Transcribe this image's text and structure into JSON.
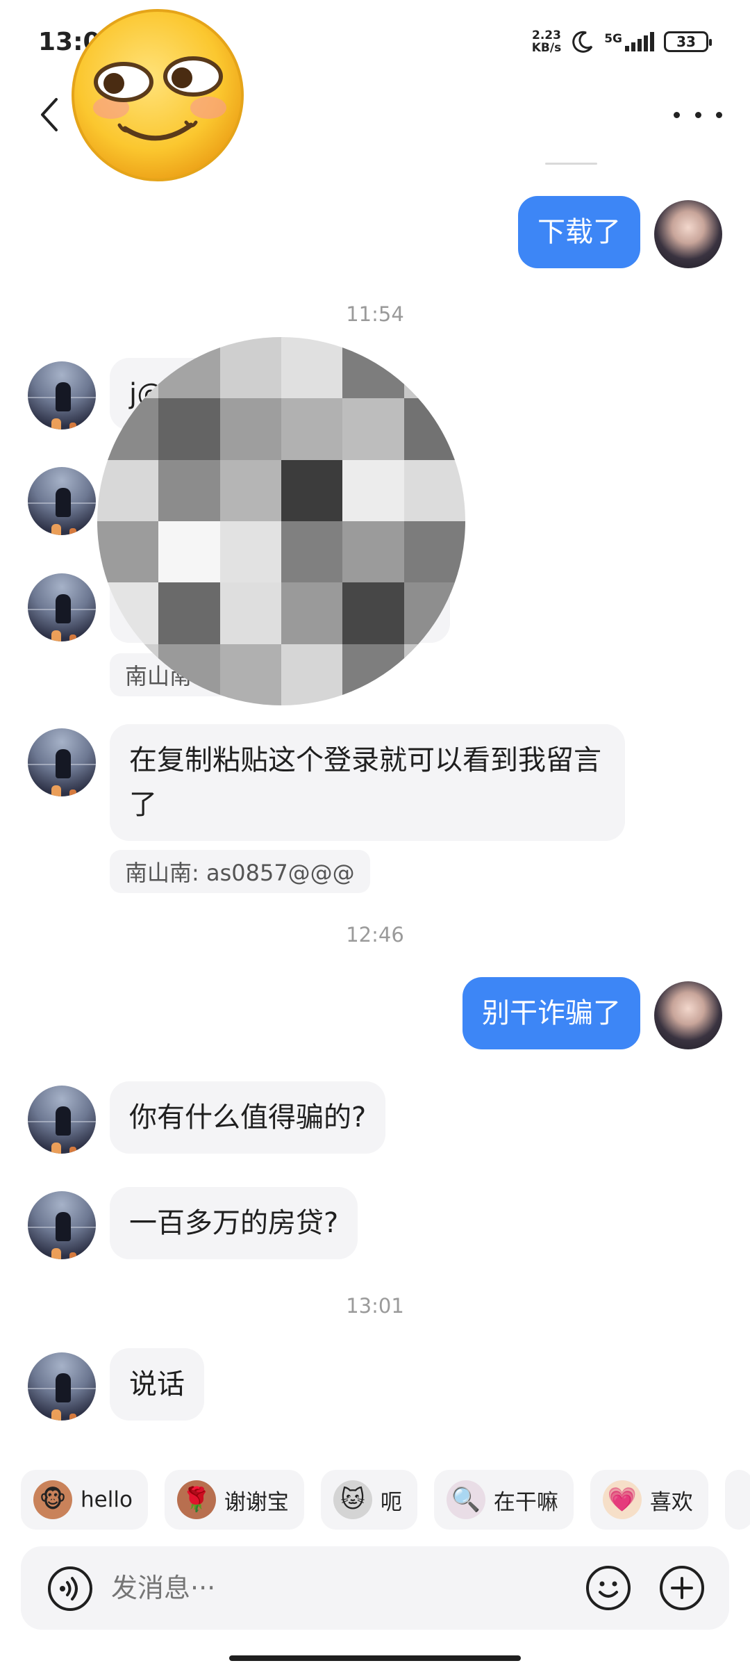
{
  "status_bar": {
    "time": "13:0",
    "net_speed_value": "2.23",
    "net_speed_unit": "KB/s",
    "network": "5G",
    "battery": "33"
  },
  "header": {
    "back_icon": "chevron-left-icon",
    "more_icon": "more-horizontal-icon",
    "sticker_icon": "smirk-emoji-sticker"
  },
  "messages": [
    {
      "from": "self",
      "text": "下载了"
    },
    {
      "type": "time",
      "text": "11:54"
    },
    {
      "from": "other",
      "text": "j@"
    },
    {
      "from": "other",
      "text": ""
    },
    {
      "from": "other",
      "text": ""
    },
    {
      "type": "quote",
      "text": "南山南"
    },
    {
      "from": "other",
      "text": "在复制粘贴这个登录就可以看到我留言了"
    },
    {
      "type": "quote",
      "text": "南山南: as0857@@@"
    },
    {
      "type": "time",
      "text": "12:46"
    },
    {
      "from": "self",
      "text": "别干诈骗了"
    },
    {
      "from": "other",
      "text": "你有什么值得骗的?"
    },
    {
      "from": "other",
      "text": "一百多万的房贷?"
    },
    {
      "type": "time",
      "text": "13:01"
    },
    {
      "from": "other",
      "text": "说话"
    }
  ],
  "quick_replies": [
    {
      "label": "hello",
      "icon": "monkey-sticker-icon"
    },
    {
      "label": "谢谢宝",
      "icon": "monkey-flower-sticker-icon"
    },
    {
      "label": "呃",
      "icon": "cat-sticker-icon"
    },
    {
      "label": "在干嘛",
      "icon": "magnifier-sticker-icon"
    },
    {
      "label": "喜欢",
      "icon": "love-sticker-icon"
    }
  ],
  "input": {
    "placeholder": "发消息···",
    "voice_icon": "voice-icon",
    "emoji_icon": "smile-icon",
    "plus_icon": "plus-circle-icon"
  },
  "colors": {
    "self_bubble": "#3d86f6",
    "other_bubble": "#f4f4f6"
  }
}
